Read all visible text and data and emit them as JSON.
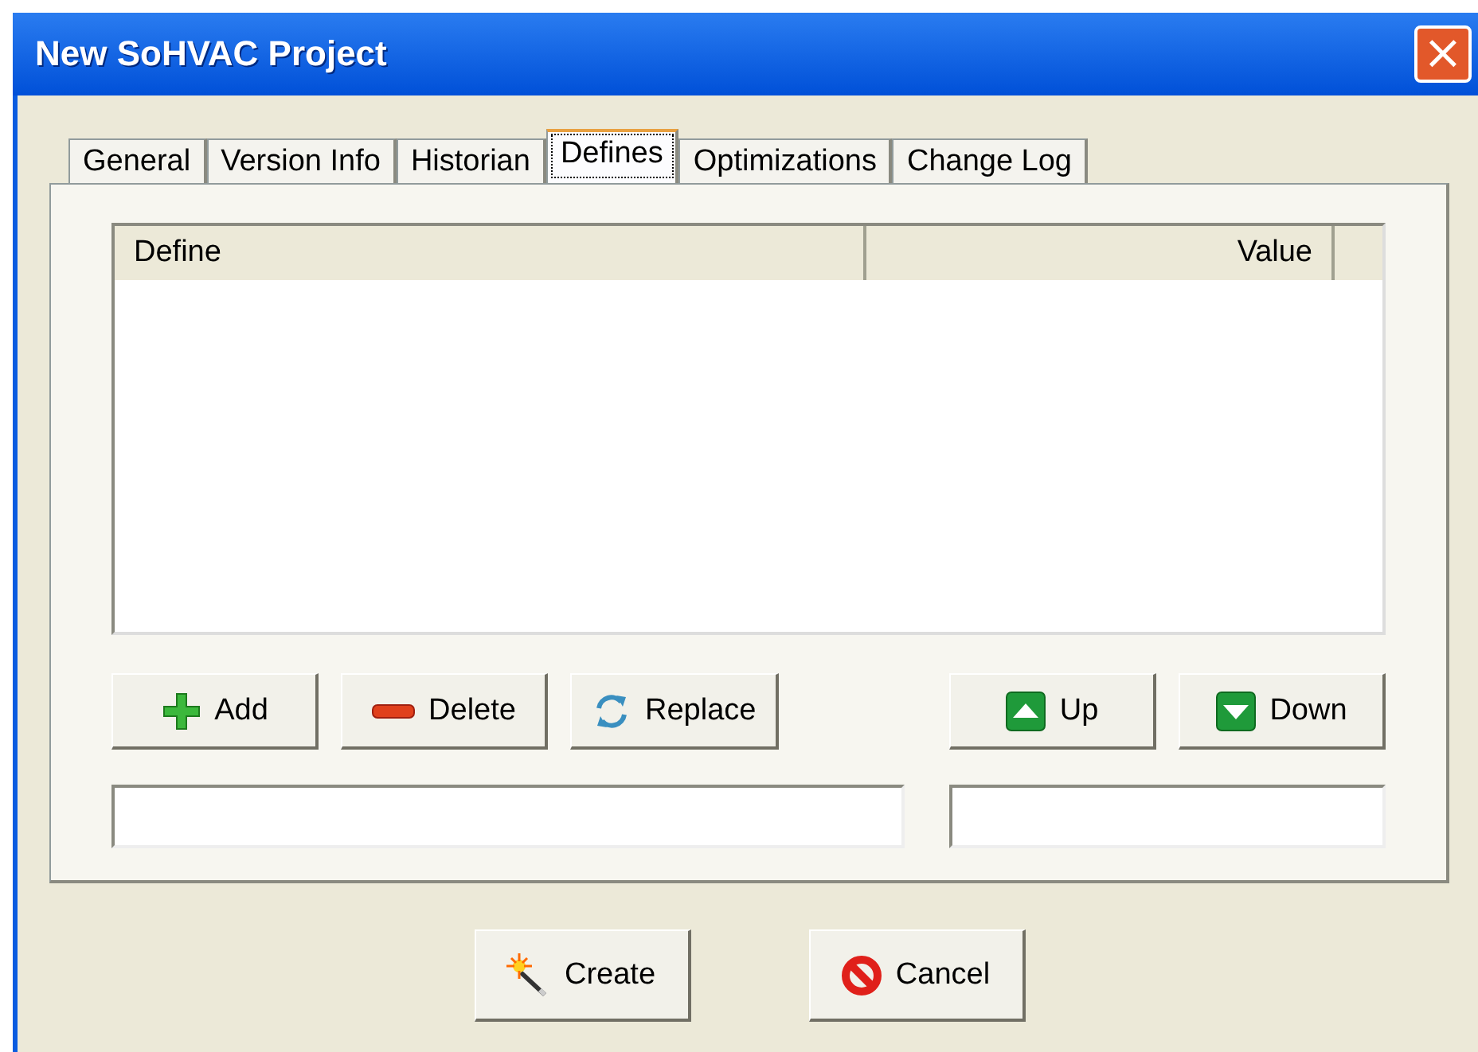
{
  "window": {
    "title": "New SoHVAC Project",
    "close": "×"
  },
  "tabs": [
    {
      "label": "General",
      "selected": false
    },
    {
      "label": "Version Info",
      "selected": false
    },
    {
      "label": "Historian",
      "selected": false
    },
    {
      "label": "Defines",
      "selected": true
    },
    {
      "label": "Optimizations",
      "selected": false
    },
    {
      "label": "Change Log",
      "selected": false
    }
  ],
  "table": {
    "columns": [
      "Define",
      "Value"
    ]
  },
  "edit_buttons": [
    {
      "label": "Add",
      "kind": "plus"
    },
    {
      "label": "Delete",
      "kind": "minus"
    },
    {
      "label": "Replace",
      "kind": "cycle"
    }
  ],
  "move_buttons": [
    {
      "label": "Up",
      "kind": "up"
    },
    {
      "label": "Down",
      "kind": "down"
    }
  ],
  "fields": [
    {
      "kind": "define"
    },
    {
      "kind": "value"
    }
  ],
  "dialog_buttons": [
    {
      "label": "Create",
      "kind": "wand"
    },
    {
      "label": "Cancel",
      "kind": "cancel"
    }
  ]
}
